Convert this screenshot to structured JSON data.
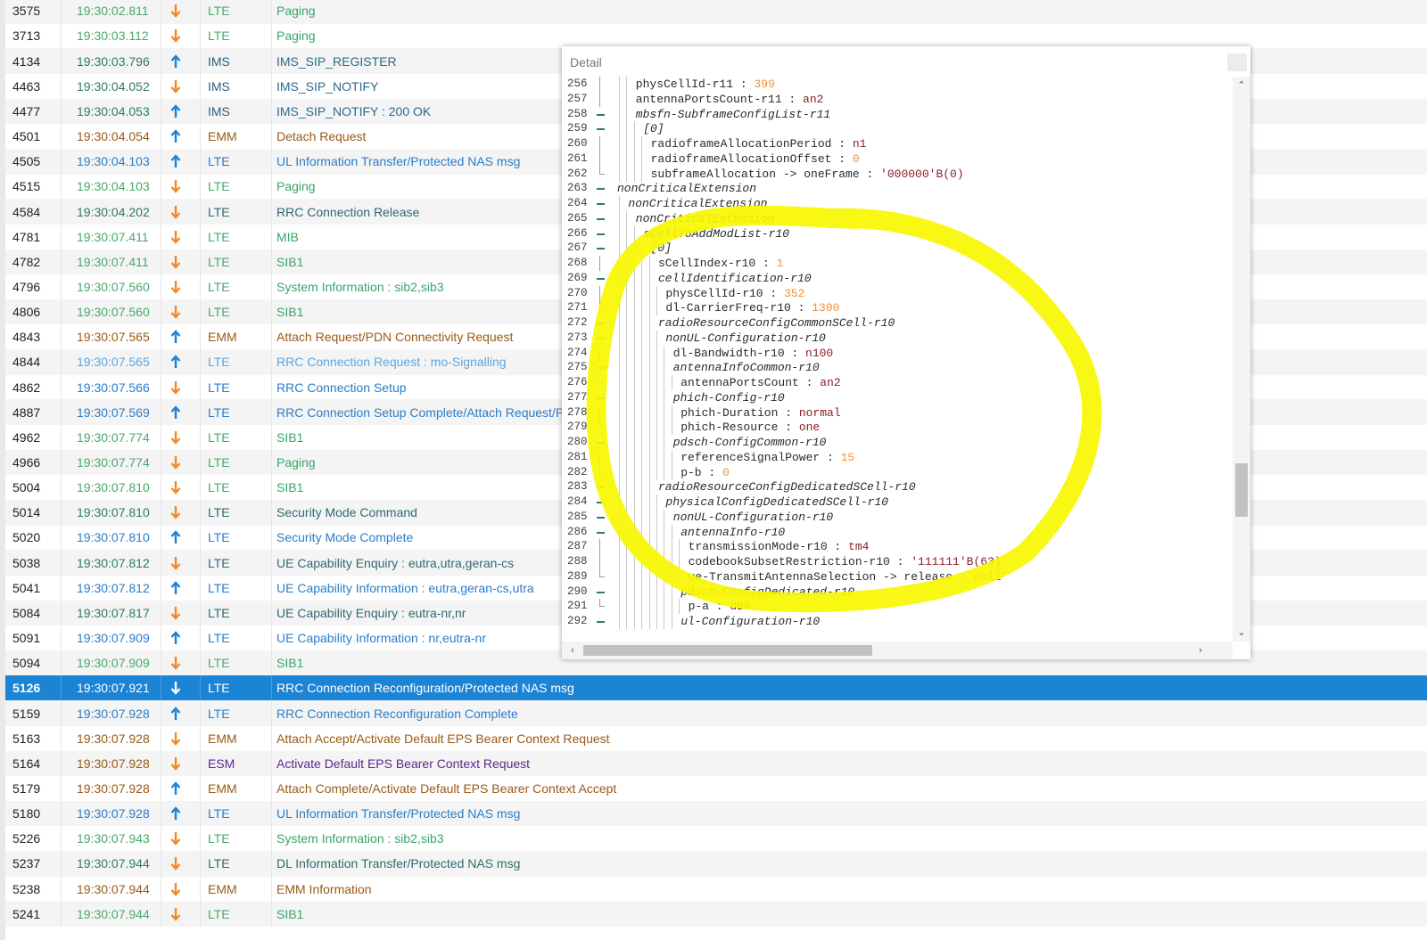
{
  "colors": {
    "LTE_time": "#4aa86c",
    "LTE_name_blue": "#2b7dc9",
    "LTE_name_green": "#3aa56a",
    "IMS": "#2b6a8c",
    "EMM": "#9a5a14",
    "ESM": "#5a2a8a",
    "selected_bg": "#1c84d4",
    "highlight": "#f7f700"
  },
  "messages": [
    {
      "idx": "3575",
      "time": "19:30:02.811",
      "dir": "down",
      "proto": "LTE",
      "name": "Paging",
      "tc": "#4aa86c",
      "pc": "#4aa86c",
      "nc": "#3aa56a"
    },
    {
      "idx": "3713",
      "time": "19:30:03.112",
      "dir": "down",
      "proto": "LTE",
      "name": "Paging",
      "tc": "#4aa86c",
      "pc": "#4aa86c",
      "nc": "#3aa56a"
    },
    {
      "idx": "4134",
      "time": "19:30:03.796",
      "dir": "up",
      "proto": "IMS",
      "name": "IMS_SIP_REGISTER",
      "tc": "#2e7a66",
      "pc": "#2b5f7e",
      "nc": "#2b6a8c"
    },
    {
      "idx": "4463",
      "time": "19:30:04.052",
      "dir": "down",
      "proto": "IMS",
      "name": "IMS_SIP_NOTIFY",
      "tc": "#2e7a66",
      "pc": "#2b5f7e",
      "nc": "#2b6a8c"
    },
    {
      "idx": "4477",
      "time": "19:30:04.053",
      "dir": "up",
      "proto": "IMS",
      "name": "IMS_SIP_NOTIFY : 200 OK",
      "tc": "#2e7a66",
      "pc": "#2b5f7e",
      "nc": "#2b6a8c"
    },
    {
      "idx": "4501",
      "time": "19:30:04.054",
      "dir": "up",
      "proto": "EMM",
      "name": "Detach Request",
      "tc": "#9a5a14",
      "pc": "#9a5a14",
      "nc": "#9a5a14"
    },
    {
      "idx": "4505",
      "time": "19:30:04.103",
      "dir": "up",
      "proto": "LTE",
      "name": "UL Information Transfer/Protected NAS msg",
      "tc": "#2b7dc9",
      "pc": "#2b7dc9",
      "nc": "#2b7dc9"
    },
    {
      "idx": "4515",
      "time": "19:30:04.103",
      "dir": "down",
      "proto": "LTE",
      "name": "Paging",
      "tc": "#4aa86c",
      "pc": "#4aa86c",
      "nc": "#3aa56a"
    },
    {
      "idx": "4584",
      "time": "19:30:04.202",
      "dir": "down",
      "proto": "LTE",
      "name": "RRC Connection Release",
      "tc": "#2e7a66",
      "pc": "#2e6a70",
      "nc": "#2e6a70"
    },
    {
      "idx": "4781",
      "time": "19:30:07.411",
      "dir": "down",
      "proto": "LTE",
      "name": "MIB",
      "tc": "#4aa86c",
      "pc": "#4aa86c",
      "nc": "#3aa56a"
    },
    {
      "idx": "4782",
      "time": "19:30:07.411",
      "dir": "down",
      "proto": "LTE",
      "name": "SIB1",
      "tc": "#4aa86c",
      "pc": "#4aa86c",
      "nc": "#3aa56a"
    },
    {
      "idx": "4796",
      "time": "19:30:07.560",
      "dir": "down",
      "proto": "LTE",
      "name": "System Information : sib2,sib3",
      "tc": "#4aa86c",
      "pc": "#4aa86c",
      "nc": "#3aa56a"
    },
    {
      "idx": "4806",
      "time": "19:30:07.560",
      "dir": "down",
      "proto": "LTE",
      "name": "SIB1",
      "tc": "#4aa86c",
      "pc": "#4aa86c",
      "nc": "#3aa56a"
    },
    {
      "idx": "4843",
      "time": "19:30:07.565",
      "dir": "up",
      "proto": "EMM",
      "name": "Attach Request/PDN Connectivity Request",
      "tc": "#9a5a14",
      "pc": "#9a5a14",
      "nc": "#9a5a14"
    },
    {
      "idx": "4844",
      "time": "19:30:07.565",
      "dir": "up",
      "proto": "LTE",
      "name": "RRC Connection Request : mo-Signalling",
      "tc": "#5ba6e0",
      "pc": "#5ba6e0",
      "nc": "#5ba6e0"
    },
    {
      "idx": "4862",
      "time": "19:30:07.566",
      "dir": "down",
      "proto": "LTE",
      "name": "RRC Connection Setup",
      "tc": "#2b7dc9",
      "pc": "#2b7dc9",
      "nc": "#2b7dc9"
    },
    {
      "idx": "4887",
      "time": "19:30:07.569",
      "dir": "up",
      "proto": "LTE",
      "name": "RRC Connection Setup Complete/Attach Request/PDN",
      "tc": "#2b7dc9",
      "pc": "#2b7dc9",
      "nc": "#2b7dc9"
    },
    {
      "idx": "4962",
      "time": "19:30:07.774",
      "dir": "down",
      "proto": "LTE",
      "name": "SIB1",
      "tc": "#4aa86c",
      "pc": "#4aa86c",
      "nc": "#3aa56a"
    },
    {
      "idx": "4966",
      "time": "19:30:07.774",
      "dir": "down",
      "proto": "LTE",
      "name": "Paging",
      "tc": "#4aa86c",
      "pc": "#4aa86c",
      "nc": "#3aa56a"
    },
    {
      "idx": "5004",
      "time": "19:30:07.810",
      "dir": "down",
      "proto": "LTE",
      "name": "SIB1",
      "tc": "#4aa86c",
      "pc": "#4aa86c",
      "nc": "#3aa56a"
    },
    {
      "idx": "5014",
      "time": "19:30:07.810",
      "dir": "down",
      "proto": "LTE",
      "name": "Security Mode Command",
      "tc": "#2e7a66",
      "pc": "#2e6a70",
      "nc": "#2e6a70"
    },
    {
      "idx": "5020",
      "time": "19:30:07.810",
      "dir": "up",
      "proto": "LTE",
      "name": "Security Mode Complete",
      "tc": "#2b7dc9",
      "pc": "#2b7dc9",
      "nc": "#2b7dc9"
    },
    {
      "idx": "5038",
      "time": "19:30:07.812",
      "dir": "down",
      "proto": "LTE",
      "name": "UE Capability Enquiry : eutra,utra,geran-cs",
      "tc": "#2e7a66",
      "pc": "#2e6a70",
      "nc": "#2e6a70"
    },
    {
      "idx": "5041",
      "time": "19:30:07.812",
      "dir": "up",
      "proto": "LTE",
      "name": "UE Capability Information : eutra,geran-cs,utra",
      "tc": "#2b7dc9",
      "pc": "#2b7dc9",
      "nc": "#2b7dc9"
    },
    {
      "idx": "5084",
      "time": "19:30:07.817",
      "dir": "down",
      "proto": "LTE",
      "name": "UE Capability Enquiry : eutra-nr,nr",
      "tc": "#2e7a66",
      "pc": "#2e6a70",
      "nc": "#2e6a70"
    },
    {
      "idx": "5091",
      "time": "19:30:07.909",
      "dir": "up",
      "proto": "LTE",
      "name": "UE Capability Information : nr,eutra-nr",
      "tc": "#2b7dc9",
      "pc": "#2b7dc9",
      "nc": "#2b7dc9"
    },
    {
      "idx": "5094",
      "time": "19:30:07.909",
      "dir": "down",
      "proto": "LTE",
      "name": "SIB1",
      "tc": "#4aa86c",
      "pc": "#4aa86c",
      "nc": "#3aa56a"
    },
    {
      "idx": "5126",
      "time": "19:30:07.921",
      "dir": "down",
      "proto": "LTE",
      "name": "RRC Connection Reconfiguration/Protected NAS msg",
      "tc": "#ffffff",
      "pc": "#ffffff",
      "nc": "#ffffff",
      "selected": true
    },
    {
      "idx": "5159",
      "time": "19:30:07.928",
      "dir": "up",
      "proto": "LTE",
      "name": "RRC Connection Reconfiguration Complete",
      "tc": "#2b7dc9",
      "pc": "#2b7dc9",
      "nc": "#2b7dc9"
    },
    {
      "idx": "5163",
      "time": "19:30:07.928",
      "dir": "down",
      "proto": "EMM",
      "name": "Attach Accept/Activate Default EPS Bearer Context Request",
      "tc": "#9a5a14",
      "pc": "#9a5a14",
      "nc": "#9a5a14"
    },
    {
      "idx": "5164",
      "time": "19:30:07.928",
      "dir": "down",
      "proto": "ESM",
      "name": "Activate Default EPS Bearer Context Request",
      "tc": "#9a5a14",
      "pc": "#5a2a8a",
      "nc": "#5a2a8a"
    },
    {
      "idx": "5179",
      "time": "19:30:07.928",
      "dir": "up",
      "proto": "EMM",
      "name": "Attach Complete/Activate Default EPS Bearer Context Accept",
      "tc": "#9a5a14",
      "pc": "#9a5a14",
      "nc": "#9a5a14"
    },
    {
      "idx": "5180",
      "time": "19:30:07.928",
      "dir": "up",
      "proto": "LTE",
      "name": "UL Information Transfer/Protected NAS msg",
      "tc": "#2b7dc9",
      "pc": "#2b7dc9",
      "nc": "#2b7dc9"
    },
    {
      "idx": "5226",
      "time": "19:30:07.943",
      "dir": "down",
      "proto": "LTE",
      "name": "System Information : sib2,sib3",
      "tc": "#4aa86c",
      "pc": "#4aa86c",
      "nc": "#3aa56a"
    },
    {
      "idx": "5237",
      "time": "19:30:07.944",
      "dir": "down",
      "proto": "LTE",
      "name": "DL Information Transfer/Protected NAS msg",
      "tc": "#2e7a66",
      "pc": "#2e6a70",
      "nc": "#2e6a70"
    },
    {
      "idx": "5238",
      "time": "19:30:07.944",
      "dir": "down",
      "proto": "EMM",
      "name": "EMM Information",
      "tc": "#9a5a14",
      "pc": "#9a5a14",
      "nc": "#9a5a14"
    },
    {
      "idx": "5241",
      "time": "19:30:07.944",
      "dir": "down",
      "proto": "LTE",
      "name": "SIB1",
      "tc": "#4aa86c",
      "pc": "#4aa86c",
      "nc": "#3aa56a"
    }
  ],
  "detail": {
    "title": "Detail",
    "lines": [
      {
        "n": "256",
        "d": 2,
        "f": "bar",
        "k": "physCellId-r11",
        "v": "399",
        "vt": "num"
      },
      {
        "n": "257",
        "d": 2,
        "f": "bar",
        "k": "antennaPortsCount-r11",
        "v": "an2",
        "vt": "enum"
      },
      {
        "n": "258",
        "d": 2,
        "f": "minus",
        "k": "mbsfn-SubframeConfigList-r11",
        "i": true
      },
      {
        "n": "259",
        "d": 3,
        "f": "minus",
        "k": "[0]",
        "i": true
      },
      {
        "n": "260",
        "d": 4,
        "f": "bar",
        "k": "radioframeAllocationPeriod",
        "v": "n1",
        "vt": "enum"
      },
      {
        "n": "261",
        "d": 4,
        "f": "bar",
        "k": "radioframeAllocationOffset",
        "v": "0",
        "vt": "num"
      },
      {
        "n": "262",
        "d": 4,
        "f": "end",
        "k": "subframeAllocation -> oneFrame",
        "v": "'000000'B(0)",
        "vt": "str"
      },
      {
        "n": "263",
        "d": 0,
        "f": "minus",
        "k": "nonCriticalExtension",
        "i": true
      },
      {
        "n": "264",
        "d": 1,
        "f": "minus",
        "k": "nonCriticalExtension",
        "i": true
      },
      {
        "n": "265",
        "d": 2,
        "f": "minus",
        "k": "nonCriticalExtension",
        "i": true
      },
      {
        "n": "266",
        "d": 3,
        "f": "minus",
        "k": "sCellToAddModList-r10",
        "i": true
      },
      {
        "n": "267",
        "d": 4,
        "f": "minus",
        "k": "[0]",
        "i": true
      },
      {
        "n": "268",
        "d": 5,
        "f": "bar",
        "k": "sCellIndex-r10",
        "v": "1",
        "vt": "num"
      },
      {
        "n": "269",
        "d": 5,
        "f": "minus",
        "k": "cellIdentification-r10",
        "i": true
      },
      {
        "n": "270",
        "d": 6,
        "f": "bar",
        "k": "physCellId-r10",
        "v": "352",
        "vt": "num"
      },
      {
        "n": "271",
        "d": 6,
        "f": "end",
        "k": "dl-CarrierFreq-r10",
        "v": "1300",
        "vt": "num"
      },
      {
        "n": "272",
        "d": 5,
        "f": "minus",
        "k": "radioResourceConfigCommonSCell-r10",
        "i": true
      },
      {
        "n": "273",
        "d": 6,
        "f": "minus",
        "k": "nonUL-Configuration-r10",
        "i": true
      },
      {
        "n": "274",
        "d": 7,
        "f": "bar",
        "k": "dl-Bandwidth-r10",
        "v": "n100",
        "vt": "enum"
      },
      {
        "n": "275",
        "d": 7,
        "f": "minus",
        "k": "antennaInfoCommon-r10",
        "i": true
      },
      {
        "n": "276",
        "d": 8,
        "f": "end",
        "k": "antennaPortsCount",
        "v": "an2",
        "vt": "enum"
      },
      {
        "n": "277",
        "d": 7,
        "f": "minus",
        "k": "phich-Config-r10",
        "i": true
      },
      {
        "n": "278",
        "d": 8,
        "f": "bar",
        "k": "phich-Duration",
        "v": "normal",
        "vt": "enum"
      },
      {
        "n": "279",
        "d": 8,
        "f": "end",
        "k": "phich-Resource",
        "v": "one",
        "vt": "enum"
      },
      {
        "n": "280",
        "d": 7,
        "f": "minus",
        "k": "pdsch-ConfigCommon-r10",
        "i": true
      },
      {
        "n": "281",
        "d": 8,
        "f": "bar",
        "k": "referenceSignalPower",
        "v": "15",
        "vt": "num"
      },
      {
        "n": "282",
        "d": 8,
        "f": "end",
        "k": "p-b",
        "v": "0",
        "vt": "num"
      },
      {
        "n": "283",
        "d": 5,
        "f": "minus",
        "k": "radioResourceConfigDedicatedSCell-r10",
        "i": true
      },
      {
        "n": "284",
        "d": 6,
        "f": "minus",
        "k": "physicalConfigDedicatedSCell-r10",
        "i": true
      },
      {
        "n": "285",
        "d": 7,
        "f": "minus",
        "k": "nonUL-Configuration-r10",
        "i": true
      },
      {
        "n": "286",
        "d": 8,
        "f": "minus",
        "k": "antennaInfo-r10",
        "i": true
      },
      {
        "n": "287",
        "d": 9,
        "f": "bar",
        "k": "transmissionMode-r10",
        "v": "tm4",
        "vt": "enum"
      },
      {
        "n": "288",
        "d": 9,
        "f": "bar",
        "k": "codebookSubsetRestriction-r10",
        "v": "'111111'B(63)",
        "vt": "str"
      },
      {
        "n": "289",
        "d": 9,
        "f": "end",
        "k": "ue-TransmitAntennaSelection -> release",
        "v": "null",
        "vt": "enum"
      },
      {
        "n": "290",
        "d": 8,
        "f": "minus",
        "k": "pdsch-ConfigDedicated-r10",
        "i": true
      },
      {
        "n": "291",
        "d": 9,
        "f": "end",
        "k": "p-a",
        "v": "dB0",
        "vt": "enum"
      },
      {
        "n": "292",
        "d": 8,
        "f": "minus",
        "k": "ul-Configuration-r10",
        "i": true
      }
    ]
  }
}
